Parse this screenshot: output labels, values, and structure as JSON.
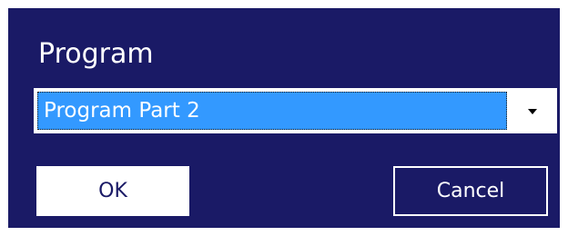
{
  "dialog": {
    "title": "Program",
    "program_select": {
      "selected_value": "Program Part 2"
    },
    "buttons": {
      "ok_label": "OK",
      "cancel_label": "Cancel"
    }
  },
  "icons": {
    "dropdown": "chevron-down-icon"
  },
  "colors": {
    "dialog_background": "#1a1a66",
    "selection_highlight": "#3399ff",
    "text_light": "#ffffff"
  }
}
